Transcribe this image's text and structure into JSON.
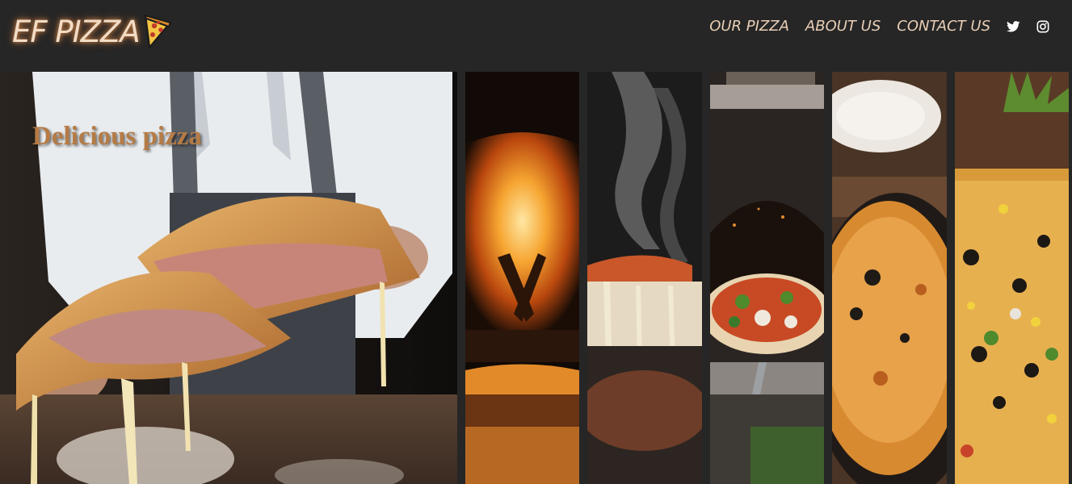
{
  "brand": {
    "name": "EF PIZZA",
    "icon": "pizza-slice-icon"
  },
  "nav": {
    "items": [
      {
        "label": "OUR PIZZA"
      },
      {
        "label": "ABOUT US"
      },
      {
        "label": "CONTACT US"
      }
    ],
    "social": [
      {
        "icon": "twitter-icon"
      },
      {
        "icon": "instagram-icon"
      }
    ]
  },
  "hero": {
    "title": "Delicious pizza"
  },
  "gallery": [
    {
      "subject": "wood-fired-oven-flames"
    },
    {
      "subject": "steaming-cheese-pull-slice"
    },
    {
      "subject": "pizza-oven-peel"
    },
    {
      "subject": "baked-pizza-plate"
    },
    {
      "subject": "olive-corn-pizza"
    }
  ],
  "colors": {
    "accent": "#b57b46",
    "nav_text": "#e9cfb6",
    "bar": "#262626"
  }
}
